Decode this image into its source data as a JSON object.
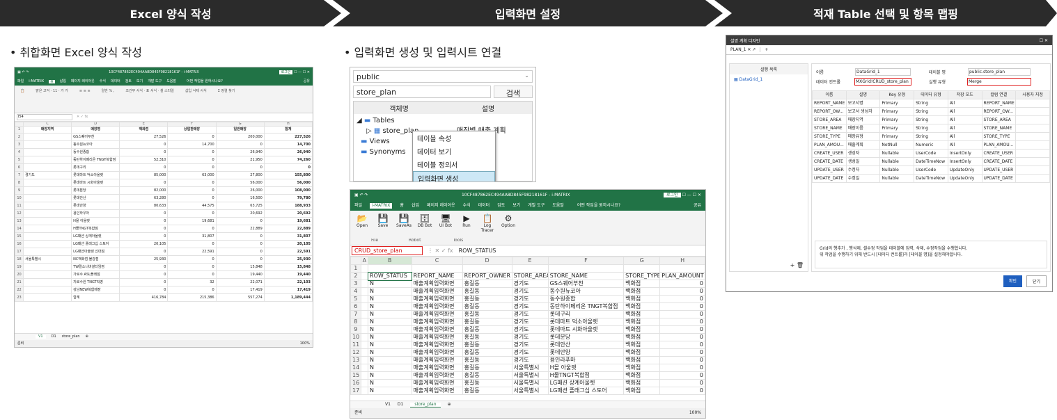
{
  "steps": [
    {
      "label": "Excel 양식 작성"
    },
    {
      "label": "입력화면 설정"
    },
    {
      "label": "적재 Table 선택 및 항목 맵핑"
    }
  ],
  "bullets": {
    "b1": "• 취합화면 Excel 양식 작성",
    "b2": "• 입력화면 생성 및 입력시트 연결"
  },
  "excel1": {
    "title": "10CF487862EC494AA8D845F98218161F - i-MATRIX",
    "login": "로그인",
    "tabs": [
      "파일",
      "i-MATRIX",
      "홈",
      "삽입",
      "페이지 레이아웃",
      "수식",
      "데이터",
      "검토",
      "보기",
      "개발 도구",
      "도움말"
    ],
    "tellme": "어떤 작업을 원하시나요?",
    "share": "공유",
    "namebox": "I54",
    "cols": [
      "C",
      "D",
      "E",
      "F",
      "G",
      "H"
    ],
    "header": [
      "매장지역",
      "매장명",
      "백화점",
      "상업판매장",
      "일반매장",
      "합계"
    ],
    "rows": [
      [
        "",
        "GS스퀘어부천",
        "27,526",
        "0",
        "200,000",
        "227,526"
      ],
      [
        "",
        "동수원뉴코아",
        "0",
        "14,700",
        "0",
        "14,700"
      ],
      [
        "",
        "동수원종합",
        "0",
        "0",
        "26,940",
        "26,940"
      ],
      [
        "",
        "동탄하이페리온 TNGT복합점",
        "52,310",
        "0",
        "21,950",
        "74,260"
      ],
      [
        "",
        "롯데구리",
        "0",
        "0",
        "0",
        "0"
      ],
      [
        "경기도",
        "롯데마트 덕소아울렛",
        "85,000",
        "63,000",
        "27,800",
        "155,800"
      ],
      [
        "",
        "롯데마트 시화아울렛",
        "0",
        "0",
        "56,000",
        "56,000"
      ],
      [
        "",
        "롯데분당",
        "82,000",
        "0",
        "26,000",
        "108,000"
      ],
      [
        "",
        "롯데안산",
        "63,280",
        "0",
        "16,500",
        "79,780"
      ],
      [
        "",
        "롯데안양",
        "80,633",
        "44,575",
        "63,725",
        "188,933"
      ],
      [
        "",
        "용인하우아",
        "0",
        "0",
        "20,692",
        "20,692"
      ],
      [
        "",
        "H몰 아울렛",
        "0",
        "19,681",
        "0",
        "19,681"
      ],
      [
        "",
        "H몰TNGT복합점",
        "0",
        "0",
        "22,889",
        "22,889"
      ],
      [
        "",
        "LG패션 상계아울렛",
        "0",
        "31,807",
        "0",
        "31,807"
      ],
      [
        "",
        "LG패션 플래그십 스토어",
        "20,105",
        "0",
        "0",
        "20,105"
      ],
      [
        "",
        "LG패션아울렛 신대점",
        "0",
        "22,591",
        "0",
        "22,591"
      ],
      [
        "서울특별시",
        "NC백화점 불광점",
        "25,930",
        "0",
        "0",
        "25,930"
      ],
      [
        "",
        "TW컬소니버셜타임점",
        "0",
        "0",
        "15,848",
        "15,848"
      ],
      [
        "",
        "가로수 ASL플래점",
        "0",
        "0",
        "19,440",
        "19,440"
      ],
      [
        "",
        "지로수원 TNGT직영",
        "0",
        "32",
        "22,071",
        "22,103"
      ],
      [
        "",
        "강남NEW복합매장",
        "0",
        "0",
        "17,419",
        "17,419"
      ],
      [
        "",
        "합계",
        "416,784",
        "215,386",
        "557,274",
        "1,189,444"
      ]
    ],
    "sheets": [
      "V1",
      "D1",
      "store_plan"
    ],
    "status": "준비",
    "zoom": "100%"
  },
  "dialog1": {
    "schema": "public",
    "search_value": "store_plan",
    "search_btn": "검색",
    "col1": "객체명",
    "col2": "설명",
    "tables": "Tables",
    "store_plan": "store_plan",
    "store_plan_desc": "매장별 매출 계획",
    "views": "Views",
    "synonyms": "Synonyms",
    "menu": [
      "테이블 속성",
      "데이터 보기",
      "테이블 정의서",
      "입력화면 생성"
    ]
  },
  "excel2": {
    "title": "10CF487862EC494AA8D845F98218161F - i-MATRIX",
    "login": "로그인",
    "tabs": [
      "파일",
      "i-MATRIX",
      "홈",
      "삽입",
      "페이지 레이아웃",
      "수식",
      "데이터",
      "검토",
      "보기",
      "개발 도구",
      "도움말"
    ],
    "tellme": "어떤 작업을 원하시나요?",
    "share": "공유",
    "ribbon": [
      {
        "label": "Open"
      },
      {
        "label": "Save"
      },
      {
        "label": "SaveAs"
      },
      {
        "label": "DB Bot"
      },
      {
        "label": "UI Bot"
      },
      {
        "label": "Run"
      },
      {
        "label": "Log Tracer"
      },
      {
        "label": "Option"
      }
    ],
    "groups": [
      "File",
      "Robot",
      "Tools"
    ],
    "namebox": "CRUD_store_plan",
    "formula": "ROW_STATUS",
    "cols": [
      "A",
      "B",
      "C",
      "D",
      "E",
      "F",
      "G",
      "H"
    ],
    "header": [
      "ROW_STATUS",
      "REPORT_NAME",
      "REPORT_OWNER",
      "STORE_AREA",
      "STORE_NAME",
      "STORE_TYPE",
      "PLAN_AMOUNT"
    ],
    "rows": [
      [
        "N",
        "매출계획입력화면",
        "홍길동",
        "경기도",
        "GS스퀘어부천",
        "백화점",
        "0"
      ],
      [
        "N",
        "매출계획입력화면",
        "홍길동",
        "경기도",
        "동수원뉴코아",
        "백화점",
        "0"
      ],
      [
        "N",
        "매출계획입력화면",
        "홍길동",
        "경기도",
        "동수원종합",
        "백화점",
        "0"
      ],
      [
        "N",
        "매출계획입력화면",
        "홍길동",
        "경기도",
        "동탄하이페리온 TNGT복합점",
        "백화점",
        "0"
      ],
      [
        "N",
        "매출계획입력화면",
        "홍길동",
        "경기도",
        "롯데구리",
        "백화점",
        "0"
      ],
      [
        "N",
        "매출계획입력화면",
        "홍길동",
        "경기도",
        "롯데마트 덕소아울렛",
        "백화점",
        "0"
      ],
      [
        "N",
        "매출계획입력화면",
        "홍길동",
        "경기도",
        "롯데마트 시화아울렛",
        "백화점",
        "0"
      ],
      [
        "N",
        "매출계획입력화면",
        "홍길동",
        "경기도",
        "롯데분당",
        "백화점",
        "0"
      ],
      [
        "N",
        "매출계획입력화면",
        "홍길동",
        "경기도",
        "롯데안산",
        "백화점",
        "0"
      ],
      [
        "N",
        "매출계획입력화면",
        "홍길동",
        "경기도",
        "롯데안양",
        "백화점",
        "0"
      ],
      [
        "N",
        "매출계획입력화면",
        "홍길동",
        "경기도",
        "용인라푸마",
        "백화점",
        "0"
      ],
      [
        "N",
        "매출계획입력화면",
        "홍길동",
        "서울특별시",
        "H몰 아울렛",
        "백화점",
        "0"
      ],
      [
        "N",
        "매출계획입력화면",
        "홍길동",
        "서울특별시",
        "H몰TNGT복합점",
        "백화점",
        "0"
      ],
      [
        "N",
        "매출계획입력화면",
        "홍길동",
        "서울특별시",
        "LG패션 상계아울렛",
        "백화점",
        "0"
      ],
      [
        "N",
        "매출계획입력화면",
        "홍길동",
        "서울특별시",
        "LG패션 플래그십 스토어",
        "백화점",
        "0"
      ]
    ],
    "sheets": [
      "V1",
      "D1",
      "store_plan"
    ],
    "status": "준비",
    "zoom": "100%"
  },
  "dialog2": {
    "title": "설명 계획 디자인",
    "tab": "PLAN_1",
    "left_header": "설행 목록",
    "left_item": "DataGrid_1",
    "name_label": "이름",
    "name_value": "DataGrid_1",
    "table_label": "테이블 명",
    "table_value": "public.store_plan",
    "control_label": "데이터 컨트롤",
    "control_value": "MXGrid!CRUD_store_plan",
    "exec_label": "실행 유형",
    "exec_value": "Merge",
    "grid_headers": [
      "이름",
      "설명",
      "Key 유형",
      "데이터 유형",
      "저장 모드",
      "컬럼 연결",
      "사용자 지정"
    ],
    "grid_rows": [
      [
        "REPORT_NAME",
        "보고서명",
        "Primary",
        "String",
        "All",
        "REPORT_NAME",
        ""
      ],
      [
        "REPORT_OW...",
        "보고서 생성자",
        "Primary",
        "String",
        "All",
        "REPORT_OW...",
        ""
      ],
      [
        "STORE_AREA",
        "매장지역",
        "Primary",
        "String",
        "All",
        "STORE_AREA",
        ""
      ],
      [
        "STORE_NAME",
        "매장이름",
        "Primary",
        "String",
        "All",
        "STORE_NAME",
        ""
      ],
      [
        "STORE_TYPE",
        "매장유형",
        "Primary",
        "String",
        "All",
        "STORE_TYPE",
        ""
      ],
      [
        "PLAN_AMOU...",
        "매출계획",
        "NotNull",
        "Numeric",
        "All",
        "PLAN_AMOU...",
        ""
      ],
      [
        "CREATE_USER",
        "생성자",
        "Nullable",
        "UserCode",
        "InsertOnly",
        "CREATE_USER",
        ""
      ],
      [
        "CREATE_DATE",
        "생성일",
        "Nullable",
        "DateTimeNow",
        "InsertOnly",
        "CREATE_DATE",
        ""
      ],
      [
        "UPDATE_USER",
        "수정자",
        "Nullable",
        "UserCode",
        "UpdateOnly",
        "UPDATE_USER",
        ""
      ],
      [
        "UPDATE_DATE",
        "수정일",
        "Nullable",
        "DateTimeNow",
        "UpdateOnly",
        "UPDATE_DATE",
        ""
      ]
    ],
    "note1": "Grid의 행추가 , 행삭제, 셀수정 작업을 테이블에 입력, 삭제, 수정작업을 수행합니다.",
    "note2": "위 작업을 수행하기 위해 반드시 [데이터 컨트롤]과 [테이블 명]을 설정해야합니다.",
    "ok": "확인",
    "close": "닫기"
  },
  "colors": {
    "dark": "#2b2b2b",
    "excel_green": "#217346",
    "highlight": "#e02020",
    "ok_blue": "#1f5fbf"
  }
}
